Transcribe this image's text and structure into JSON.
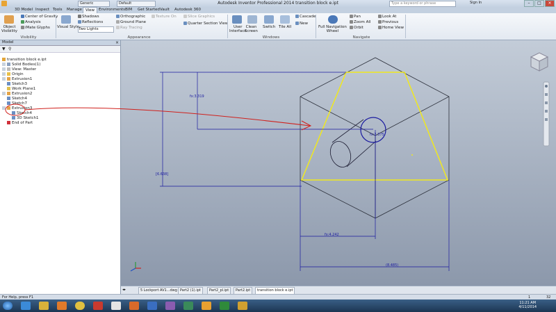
{
  "titlebar": {
    "title": "Autodesk Inventor Professional 2014   transition block e.ipt",
    "appearance_dropdown": "Generic",
    "material_dropdown": "Default",
    "search_placeholder": "Type a keyword or phrase",
    "sign_in": "Sign In"
  },
  "tabs": [
    "3D Model",
    "Inspect",
    "Tools",
    "Manage",
    "View",
    "Environments",
    "BIM",
    "Get Started",
    "Vault",
    "Autodesk 360"
  ],
  "active_tab": "View",
  "ribbon": {
    "visibility": {
      "object_visibility": "Object\nVisibility",
      "center_of_gravity": "Center of Gravity",
      "analysis": "Analysis",
      "ilogic_glyphs": "iMate Glyphs",
      "panel_label": "Visibility"
    },
    "appearance": {
      "visual_style": "Visual Style",
      "shadows": "Shadows",
      "reflections": "Reflections",
      "lighting": "Two Lights",
      "orthographic": "Orthographic",
      "ground_plane": "Ground Plane",
      "ray_tracing": "Ray Tracing",
      "texture": "Texture On",
      "slice_graphics": "Slice Graphics",
      "quarter_section": "Quarter Section View",
      "panel_label": "Appearance"
    },
    "windows": {
      "user_interface": "User\nInterface",
      "clean_screen": "Clean\nScreen",
      "switch": "Switch",
      "tile_all": "Tile All",
      "cascade": "Cascade",
      "new": "New",
      "panel_label": "Windows"
    },
    "navigate": {
      "full_nav_wheel": "Full Navigation\nWheel",
      "pan": "Pan",
      "zoom_all": "Zoom All",
      "orbit": "Orbit",
      "look_at": "Look At",
      "previous": "Previous",
      "home_view": "Home View",
      "panel_label": "Navigate"
    }
  },
  "browser": {
    "header": "Model",
    "items": [
      {
        "label": "transition block e.ipt",
        "indent": 0
      },
      {
        "label": "Solid Bodies(1)",
        "indent": 1
      },
      {
        "label": "View: Master",
        "indent": 1
      },
      {
        "label": "Origin",
        "indent": 1
      },
      {
        "label": "Extrusion1",
        "indent": 1
      },
      {
        "label": "Sketch3",
        "indent": 1
      },
      {
        "label": "Work Plane1",
        "indent": 1
      },
      {
        "label": "Extrusion2",
        "indent": 1
      },
      {
        "label": "Sketch4",
        "indent": 1
      },
      {
        "label": "Sketch7",
        "indent": 1
      },
      {
        "label": "Extrusion3",
        "indent": 1
      },
      {
        "label": "Sketch4",
        "indent": 2
      },
      {
        "label": "3D Sketch1",
        "indent": 2
      },
      {
        "label": "End of Part",
        "indent": 1
      }
    ]
  },
  "dimensions": {
    "d1": "fx:3.319",
    "d2": "[6.638]",
    "d3": "fx:2.375",
    "d4": "fx:4.242",
    "d5": "(8.485)"
  },
  "doc_tabs": [
    "5 Lockport AV1...dwg",
    "Part2 (1).ipt",
    "Part2_pl.ipt",
    "Part2.ipt",
    "transition block e.ipt"
  ],
  "active_doc_tab": "transition block e.ipt",
  "status": {
    "help": "For Help, press F1",
    "count1": "1",
    "count2": "32"
  },
  "taskbar": {
    "time": "11:21 AM",
    "date": "4/11/2014"
  },
  "colors": {
    "highlight_yellow": "#f0e81e",
    "dimension_blue": "#1a1aa0",
    "annotation_red": "#d0201c"
  }
}
